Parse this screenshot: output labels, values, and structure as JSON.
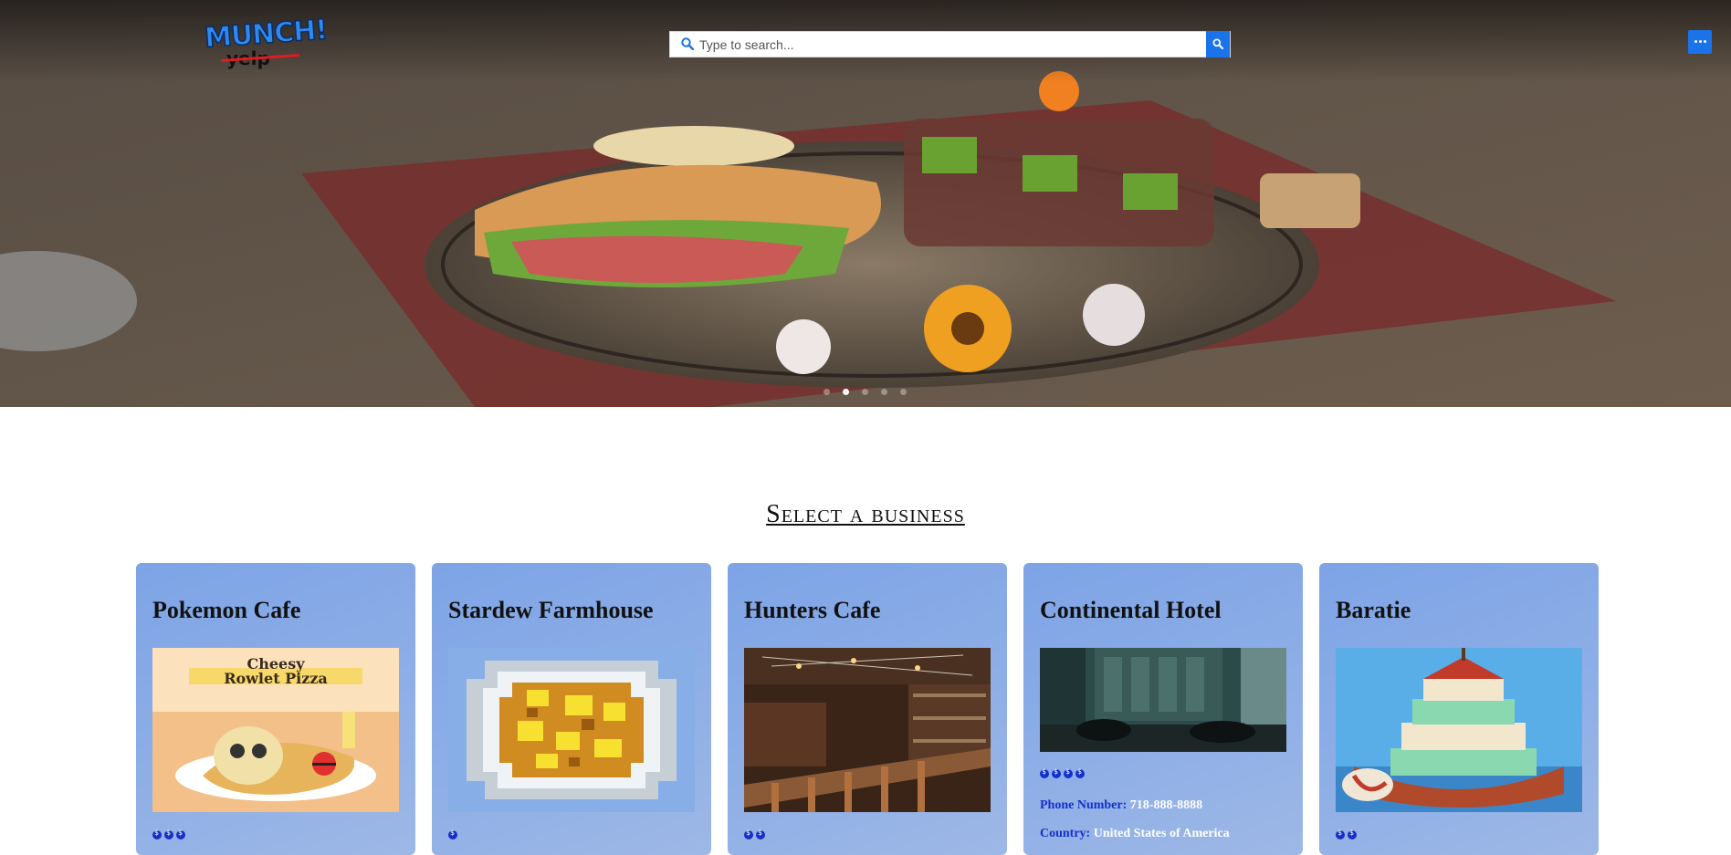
{
  "brand": {
    "logo_text": "MUNCH!",
    "logo_strike_text": "yelp"
  },
  "search": {
    "placeholder": "Type to search..."
  },
  "carousel": {
    "slide_count": 5,
    "active_index": 1
  },
  "section": {
    "title": "Select a business"
  },
  "businesses": [
    {
      "name": "Pokemon Cafe",
      "price_level": 3,
      "image_caption": "Cheesy Rowlet Pizza"
    },
    {
      "name": "Stardew Farmhouse",
      "price_level": 1
    },
    {
      "name": "Hunters Cafe",
      "price_level": 2
    },
    {
      "name": "Continental Hotel",
      "price_level": 4,
      "phone_label": "Phone Number:",
      "phone": "718-888-8888",
      "country_label": "Country:",
      "country": "United States of America"
    },
    {
      "name": "Baratie",
      "price_level": 2
    }
  ],
  "colors": {
    "accent": "#1a73e8",
    "card": "#8eaee6",
    "price_dot": "#1530c8"
  },
  "icons": {
    "search": "search-icon",
    "menu": "more-horizontal-icon"
  }
}
